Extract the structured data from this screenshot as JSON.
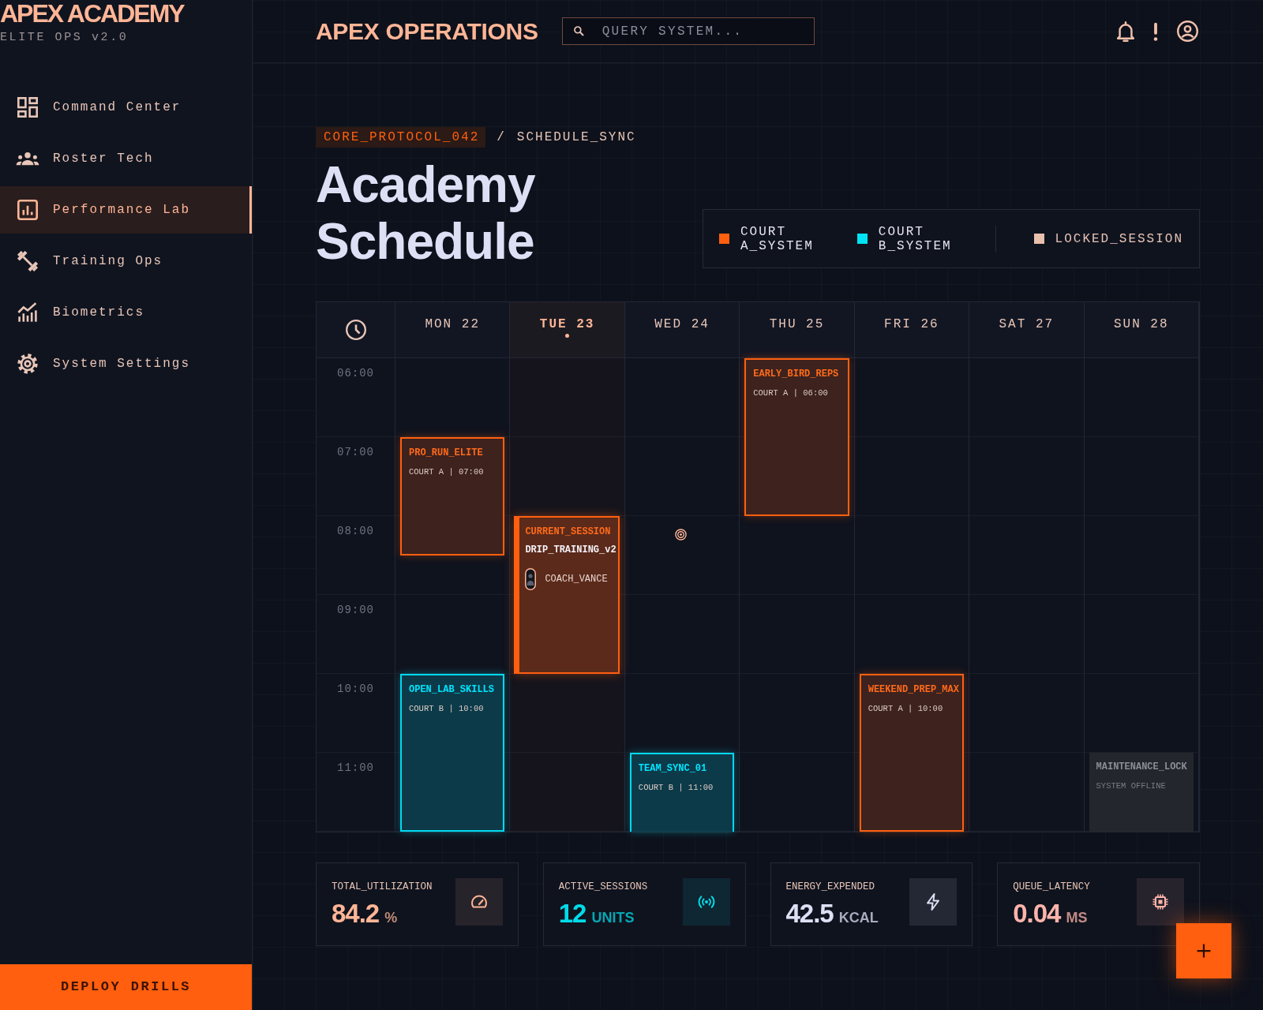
{
  "sidebar": {
    "brand": "APEX ACADEMY",
    "subtitle": "ELITE OPS v2.0",
    "items": [
      {
        "label": "Command Center",
        "selected": false
      },
      {
        "label": "Roster Tech",
        "selected": false
      },
      {
        "label": "Performance Lab",
        "selected": true
      },
      {
        "label": "Training Ops",
        "selected": false
      },
      {
        "label": "Biometrics",
        "selected": false
      },
      {
        "label": "System Settings",
        "selected": false
      }
    ],
    "action": "DEPLOY DRILLS"
  },
  "header": {
    "title": "APEX OPERATIONS",
    "search": {
      "placeholder": "QUERY SYSTEM..."
    }
  },
  "breadcrumb": [
    {
      "kind": "tag",
      "label": "CORE_PROTOCOL_042"
    },
    {
      "kind": "separator",
      "label": "/"
    },
    {
      "kind": "page",
      "label": "SCHEDULE_SYNC"
    }
  ],
  "page_title": "Academy Schedule",
  "legend": [
    {
      "kind": "court",
      "label": "COURT A_SYSTEM",
      "color": "#ff5f0f"
    },
    {
      "kind": "court",
      "label": "COURT B_SYSTEM",
      "color": "#00e3f5"
    },
    {
      "kind": "status",
      "label": "LOCKED_SESSION",
      "color": "#e9bfae"
    }
  ],
  "calendar": {
    "times": [
      "06:00",
      "07:00",
      "08:00",
      "09:00",
      "10:00",
      "11:00"
    ],
    "days": [
      {
        "label": "MON 22",
        "today": false,
        "events": [
          {
            "kind": "court_a",
            "title": "PRO_RUN_ELITE",
            "detail": "COURT A | 07:00"
          },
          {
            "kind": "court_b",
            "title": "OPEN_LAB_SKILLS",
            "detail": "COURT B | 10:00"
          }
        ]
      },
      {
        "label": "TUE 23",
        "today": true,
        "events": [
          {
            "kind": "current",
            "label": "CURRENT_SESSION",
            "title": "DRIP_TRAINING_v2",
            "coach": "COACH_VANCE"
          }
        ]
      },
      {
        "label": "WED 24",
        "today": false,
        "events": [
          {
            "kind": "court_b",
            "title": "TEAM_SYNC_01",
            "detail": "COURT B | 11:00"
          }
        ]
      },
      {
        "label": "THU 25",
        "today": false,
        "events": [
          {
            "kind": "court_a",
            "title": "EARLY_BIRD_REPS",
            "detail": "COURT A | 06:00"
          }
        ]
      },
      {
        "label": "FRI 26",
        "today": false,
        "events": [
          {
            "kind": "court_a",
            "title": "WEEKEND_PREP_MAX",
            "detail": "COURT A | 10:00"
          }
        ]
      },
      {
        "label": "SAT 27",
        "today": false
      },
      {
        "label": "SUN 28",
        "today": false,
        "events": [
          {
            "kind": "locked",
            "title": "MAINTENANCE_LOCK",
            "detail": "SYSTEM OFFLINE"
          }
        ]
      }
    ]
  },
  "stats": [
    {
      "label": "TOTAL_UTILIZATION",
      "value": "84.2",
      "unit": "%",
      "color": "#ffb596"
    },
    {
      "label": "ACTIVE_SESSIONS",
      "value": "12",
      "unit": "UNITS",
      "color": "#00dbe9"
    },
    {
      "label": "ENERGY_EXPENDED",
      "value": "42.5",
      "unit": "KCAL",
      "color": "#dde0f5"
    },
    {
      "label": "QUEUE_LATENCY",
      "value": "0.04",
      "unit": "MS",
      "color": "#ffb4ab"
    }
  ]
}
